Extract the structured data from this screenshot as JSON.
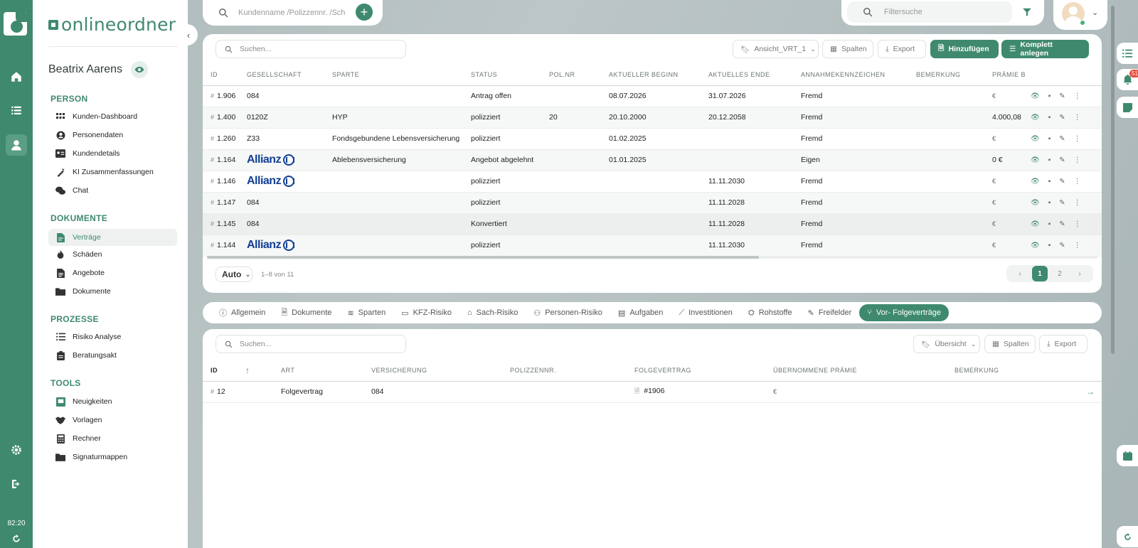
{
  "app": {
    "brand": "onlineordner",
    "time": "82:20"
  },
  "customer": {
    "name": "Beatrix Aarens"
  },
  "global_search": {
    "placeholder": "Kundenname /Polizzennr. /Sch"
  },
  "filter_search": {
    "placeholder": "Filtersuche"
  },
  "notifications": {
    "count": "51"
  },
  "sidebar": {
    "sections": [
      {
        "title": "PERSON",
        "items": [
          "Kunden-Dashboard",
          "Personendaten",
          "Kundendetails",
          "KI Zusammenfassungen",
          "Chat"
        ]
      },
      {
        "title": "DOKUMENTE",
        "items": [
          "Verträge",
          "Schäden",
          "Angebote",
          "Dokumente"
        ]
      },
      {
        "title": "PROZESSE",
        "items": [
          "Risiko Analyse",
          "Beratungsakt"
        ]
      },
      {
        "title": "TOOLS",
        "items": [
          "Neuigkeiten",
          "Vorlagen",
          "Rechner",
          "Signaturmappen"
        ]
      }
    ]
  },
  "contracts": {
    "search_placeholder": "Suchen...",
    "view": "Ansicht_VRT_1",
    "columns_label": "Spalten",
    "export_label": "Export",
    "add_label": "Hinzufügen",
    "complete_label": "Komplett anlegen",
    "headers": [
      "ID",
      "GESELLSCHAFT",
      "SPARTE",
      "STATUS",
      "POL.NR",
      "AKTUELLER BEGINN",
      "AKTUELLES ENDE",
      "ANNAHMEKENNZEICHEN",
      "BEMERKUNG",
      "PRÄMIE B"
    ],
    "rows": [
      {
        "id": "1.906",
        "company": "084",
        "branch": "",
        "status": "Antrag offen",
        "polnr": "",
        "begin": "08.07.2026",
        "end": "31.07.2026",
        "accept": "Fremd",
        "note": "",
        "premium": "€"
      },
      {
        "id": "1.400",
        "company": "0120Z",
        "branch": "HYP",
        "status": "polizziert",
        "polnr": "20",
        "begin": "20.10.2000",
        "end": "20.12.2058",
        "accept": "Fremd",
        "note": "",
        "premium": "4.000,08"
      },
      {
        "id": "1.260",
        "company": "Z33",
        "branch": "Fondsgebundene Lebensversicherung",
        "status": "polizziert",
        "polnr": "",
        "begin": "01.02.2025",
        "end": "",
        "accept": "Fremd",
        "note": "",
        "premium": "€"
      },
      {
        "id": "1.164",
        "company": "Allianz",
        "branch": "Ablebensversicherung",
        "status": "Angebot abgelehnt",
        "polnr": "",
        "begin": "01.01.2025",
        "end": "",
        "accept": "Eigen",
        "note": "",
        "premium": "0 €"
      },
      {
        "id": "1.146",
        "company": "Allianz",
        "branch": "",
        "status": "polizziert",
        "polnr": "",
        "begin": "",
        "end": "11.11.2030",
        "accept": "Fremd",
        "note": "",
        "premium": "€"
      },
      {
        "id": "1.147",
        "company": "084",
        "branch": "",
        "status": "polizziert",
        "polnr": "",
        "begin": "",
        "end": "11.11.2028",
        "accept": "Fremd",
        "note": "",
        "premium": "€"
      },
      {
        "id": "1.145",
        "company": "084",
        "branch": "",
        "status": "Konvertiert",
        "polnr": "",
        "begin": "",
        "end": "11.11.2028",
        "accept": "Fremd",
        "note": "",
        "premium": "€"
      },
      {
        "id": "1.144",
        "company": "Allianz",
        "branch": "",
        "status": "polizziert",
        "polnr": "",
        "begin": "",
        "end": "11.11.2030",
        "accept": "Fremd",
        "note": "",
        "premium": "€"
      }
    ],
    "page_size": "Auto",
    "range": "1–8 von 11",
    "pages": [
      "1",
      "2"
    ]
  },
  "tabs": [
    "Allgemein",
    "Dokumente",
    "Sparten",
    "KFZ-Risiko",
    "Sach-Risiko",
    "Personen-Risiko",
    "Aufgaben",
    "Investitionen",
    "Rohstoffe",
    "Freifelder",
    "Vor- Folgeverträge"
  ],
  "followups": {
    "search_placeholder": "Suchen...",
    "view": "Übersicht",
    "columns_label": "Spalten",
    "export_label": "Export",
    "headers": [
      "ID",
      "ART",
      "VERSICHERUNG",
      "POLIZZENNR.",
      "FOLGEVERTRAG",
      "ÜBERNOMMENE PRÄMIE",
      "BEMERKUNG"
    ],
    "rows": [
      {
        "id": "12",
        "type": "Folgevertrag",
        "insurance": "084",
        "policy": "",
        "follow": "#1906",
        "premium": "€",
        "note": ""
      }
    ]
  }
}
